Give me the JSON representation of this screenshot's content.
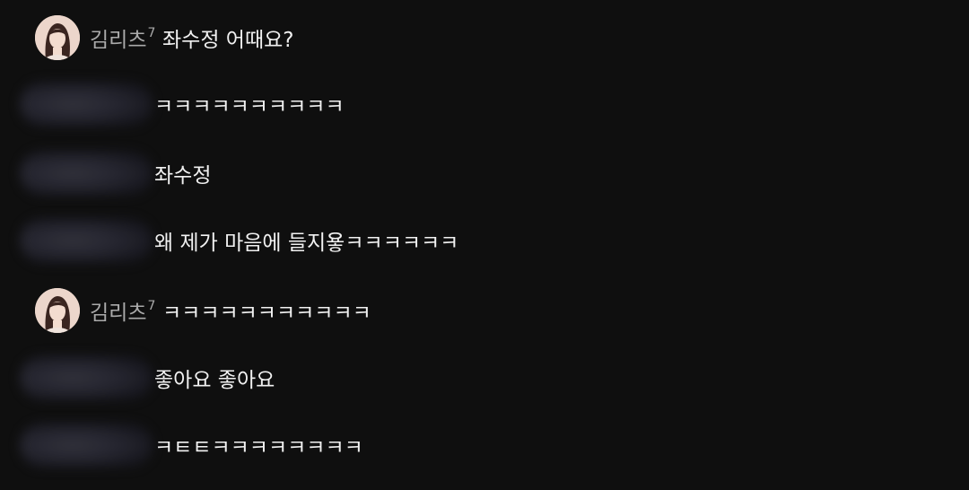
{
  "messages": [
    {
      "author": "김리츠",
      "badge": "7",
      "text": "좌수정 어때요?",
      "avatar": "profile-photo"
    },
    {
      "author": "",
      "text": "ㅋㅋㅋㅋㅋㅋㅋㅋㅋㅋ"
    },
    {
      "author": "",
      "text": "좌수정"
    },
    {
      "author": "",
      "text": "왜 제가 마음에 들지욯ㅋㅋㅋㅋㅋㅋ"
    },
    {
      "author": "김리츠",
      "badge": "7",
      "text": "ㅋㅋㅋㅋㅋㅋㅋㅋㅋㅋㅋ",
      "avatar": "profile-photo"
    },
    {
      "author": "",
      "text": "좋아요 좋아요"
    },
    {
      "author": "",
      "text": "ㅋㅌㅌㅋㅋㅋㅋㅋㅋㅋㅋ"
    }
  ],
  "colors": {
    "background": "#0f0f0f",
    "author": "#aaaaaa",
    "message": "#f1f1f1"
  }
}
